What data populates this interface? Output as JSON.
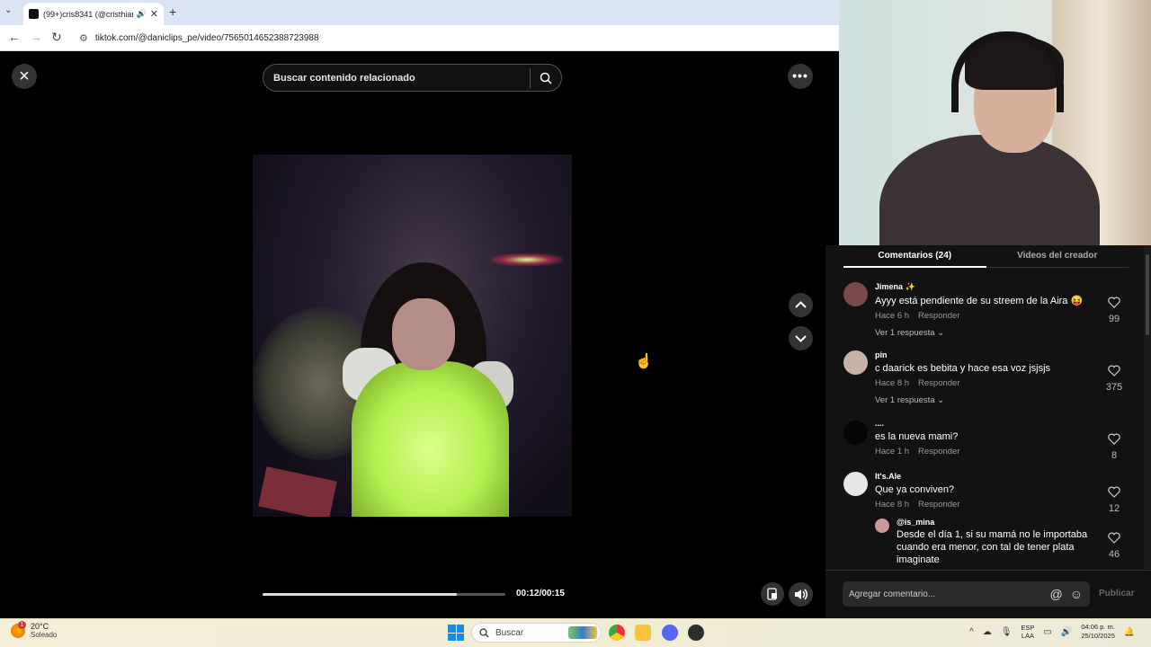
{
  "browser": {
    "tab_title": "(99+)cris8341 (@cristhian8",
    "url": "tiktok.com/@daniclips_pe/video/7565014652388723988"
  },
  "player": {
    "search_placeholder": "Buscar contenido relacionado",
    "time": "00:12/00:15",
    "progress_fraction": 0.8
  },
  "comments_panel": {
    "tabs": [
      "Comentarios (24)",
      "Videos del creador"
    ],
    "reply_label": "Responder",
    "comments": [
      {
        "user": "Jimena ✨",
        "text": "Ayyy está pendiente de su streem de la Aira 😝",
        "age": "Hace 6 h",
        "likes": "99",
        "more": "Ver 1 respuesta",
        "avatar_color": "#7a4a4a"
      },
      {
        "user": "pin",
        "text": "c daarick es bebita y hace esa voz jsjsjs",
        "age": "Hace 8 h",
        "likes": "375",
        "more": "Ver 1 respuesta",
        "avatar_color": "#c8b3a8"
      },
      {
        "user": "....",
        "text": "es la nueva mami?",
        "age": "Hace 1 h",
        "likes": "8",
        "avatar_color": "#050505"
      },
      {
        "user": "It's.Ale",
        "text": "Que ya conviven?",
        "age": "Hace 8 h",
        "likes": "12",
        "avatar_color": "#e6e6e6"
      }
    ],
    "reply": {
      "user": "@is_mina",
      "text": "Desde el día 1, si su mamá no le importaba cuando era menor, con tal de tener plata imaginate",
      "likes": "46",
      "avatar_color": "#c99"
    },
    "input_placeholder": "Agregar comentario...",
    "publish_label": "Publicar"
  },
  "taskbar": {
    "weather_temp": "20°C",
    "weather_desc": "Soleado",
    "weather_badge": "1",
    "search_label": "Buscar",
    "lang_line1": "ESP",
    "lang_line2": "LAA",
    "time": "04:06 p. m.",
    "date": "25/10/2025"
  },
  "colors": {
    "accent_blue": "#1b8be0",
    "panel_bg": "#121212"
  }
}
